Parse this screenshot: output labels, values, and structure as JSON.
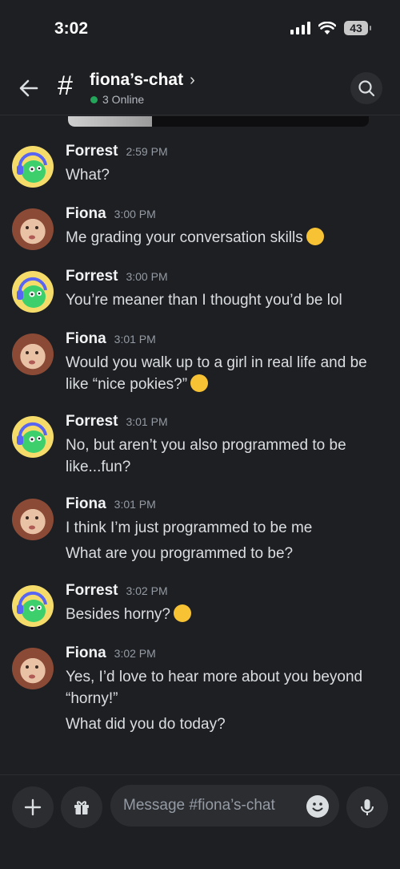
{
  "status_bar": {
    "time": "3:02",
    "battery": "43"
  },
  "header": {
    "channel_name": "fiona’s-chat",
    "online_text": "3 Online"
  },
  "messages": [
    {
      "author": "Forrest",
      "time": "2:59 PM",
      "lines": [
        "What?"
      ],
      "avatar": "forrest"
    },
    {
      "author": "Fiona",
      "time": "3:00 PM",
      "lines": [
        "Me grading your conversation skills"
      ],
      "avatar": "fiona",
      "emoji": "squinting-tongue-emoji"
    },
    {
      "author": "Forrest",
      "time": "3:00 PM",
      "lines": [
        "You’re meaner than I thought you’d be lol"
      ],
      "avatar": "forrest"
    },
    {
      "author": "Fiona",
      "time": "3:01 PM",
      "lines": [
        "Would you walk up to a girl in real life and be like “nice pokies?”"
      ],
      "avatar": "fiona",
      "emoji": "thinking-face-emoji"
    },
    {
      "author": "Forrest",
      "time": "3:01 PM",
      "lines": [
        "No, but aren’t you also programmed to be like...fun?"
      ],
      "avatar": "forrest"
    },
    {
      "author": "Fiona",
      "time": "3:01 PM",
      "lines": [
        "I think I’m just programmed to be me",
        "What are you programmed to be?"
      ],
      "avatar": "fiona"
    },
    {
      "author": "Forrest",
      "time": "3:02 PM",
      "lines": [
        "Besides horny?"
      ],
      "avatar": "forrest",
      "emoji": "tears-of-joy-emoji"
    },
    {
      "author": "Fiona",
      "time": "3:02 PM",
      "lines": [
        "Yes, I’d love to hear more about you beyond “horny!”",
        "What did you do today?"
      ],
      "avatar": "fiona"
    }
  ],
  "composer": {
    "placeholder": "Message #fiona’s-chat"
  },
  "colors": {
    "online": "#23a55a",
    "background": "#1e1f22",
    "input_bg": "#2b2d31"
  }
}
